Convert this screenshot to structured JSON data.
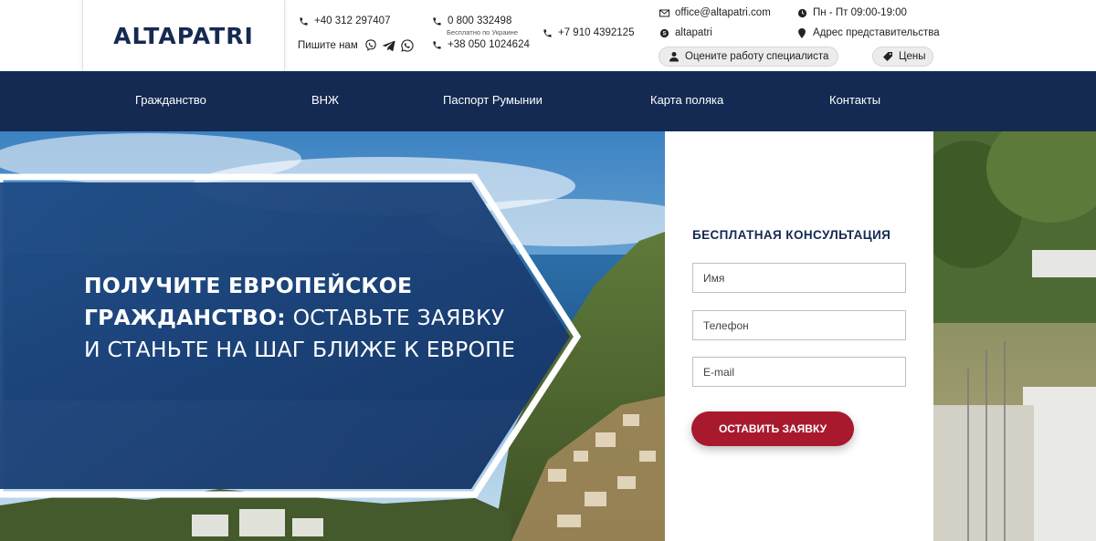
{
  "brand": {
    "logo": "ALTAPATRI"
  },
  "contacts": {
    "phone_ro": "+40 312 297407",
    "write_us": "Пишите нам",
    "messengers": [
      "viber-icon",
      "telegram-icon",
      "whatsapp-icon"
    ],
    "phone_ua_free": "0 800 332498",
    "phone_ua_free_note": "Бесплатно по Украине",
    "phone_ua": "+38 050 1024624",
    "phone_ru": "+7 910 4392125",
    "email": "office@altapatri.com",
    "skype": "altapatri",
    "hours": "Пн - Пт 09:00-19:00",
    "address": "Адрес представительства",
    "rate_button": "Оцените работу специалиста",
    "prices_button": "Цены"
  },
  "nav": {
    "items": [
      "Гражданство",
      "ВНЖ",
      "Паспорт Румынии",
      "Карта поляка",
      "Контакты"
    ]
  },
  "hero": {
    "headline_bold": "ПОЛУЧИТЕ ЕВРОПЕЙСКОЕ ГРАЖДАНСТВО:",
    "headline_rest": " ОСТАВЬТЕ ЗАЯВКУ И СТАНЬТЕ НА ШАГ БЛИЖЕ К ЕВРОПЕ"
  },
  "form": {
    "title": "БЕСПЛАТНАЯ КОНСУЛЬТАЦИЯ",
    "name_placeholder": "Имя",
    "phone_placeholder": "Телефон",
    "email_placeholder": "E-mail",
    "submit": "ОСТАВИТЬ ЗАЯВКУ"
  },
  "colors": {
    "brand_navy": "#142a52",
    "accent_red": "#a8192e",
    "panel_overlay": "#1b3f72"
  }
}
